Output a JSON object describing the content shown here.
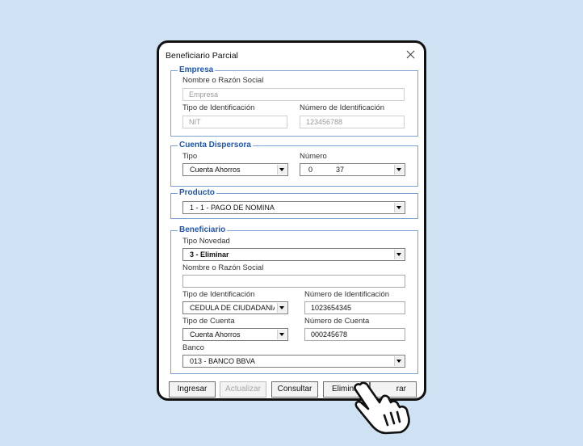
{
  "dialog": {
    "title": "Beneficiario Parcial"
  },
  "empresa": {
    "legend": "Empresa",
    "nombre_label": "Nombre o Razón Social",
    "nombre_value": "Empresa",
    "tipo_id_label": "Tipo de Identificación",
    "tipo_id_value": "NIT",
    "num_id_label": "Número  de Identificación",
    "num_id_value": "123456788"
  },
  "cuenta": {
    "legend": "Cuenta Dispersora",
    "tipo_label": "Tipo",
    "tipo_value": "Cuenta Ahorros",
    "numero_label": "Número",
    "numero_prefix": "0",
    "numero_suffix": "37"
  },
  "producto": {
    "legend": "Producto",
    "value": "1 - 1 - PAGO DE NOMINA"
  },
  "beneficiario": {
    "legend": "Beneficiario",
    "novedad_label": "Tipo Novedad",
    "novedad_value": "3 - Eliminar",
    "nombre_label": "Nombre o Razón Social",
    "nombre_value": "",
    "tipo_id_label": "Tipo de Identificación",
    "tipo_id_value": "CEDULA DE CIUDADANIA",
    "num_id_label": "Número de Identificación",
    "num_id_value": "1023654345",
    "tipo_cuenta_label": "Tipo de Cuenta",
    "tipo_cuenta_value": "Cuenta Ahorros",
    "num_cuenta_label": "Número de Cuenta",
    "num_cuenta_value": "000245678",
    "banco_label": "Banco",
    "banco_value": "013 - BANCO BBVA"
  },
  "buttons": {
    "ingresar": "Ingresar",
    "actualizar": "Actualizar",
    "consultar": "Consultar",
    "eliminar": "Eliminar",
    "cerrar_visible": "rar"
  },
  "cursor": {
    "icon": "hand-pointer-icon"
  }
}
